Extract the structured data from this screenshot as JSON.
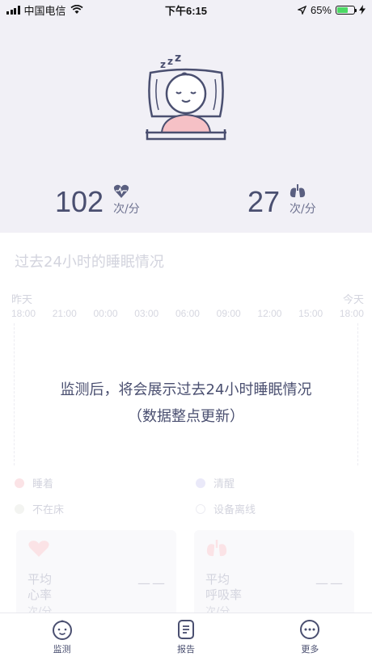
{
  "status_bar": {
    "carrier": "中国电信",
    "time": "下午6:15",
    "battery_pct": "65%",
    "battery_level": 0.65
  },
  "hero": {
    "illustration": "sleeping-baby",
    "heart_rate": {
      "value": "102",
      "unit": "次/分",
      "icon": "heart-pulse-icon"
    },
    "resp_rate": {
      "value": "27",
      "unit": "次/分",
      "icon": "lungs-icon"
    }
  },
  "sleep": {
    "title": "过去24小时的睡眠情况",
    "start_day": "昨天",
    "end_day": "今天",
    "times": [
      "18:00",
      "21:00",
      "00:00",
      "03:00",
      "06:00",
      "09:00",
      "12:00",
      "15:00",
      "18:00"
    ],
    "empty_line1": "监测后，将会展示过去24小时睡眠情况",
    "empty_line2": "（数据整点更新）",
    "legend": [
      {
        "label": "睡着",
        "color": "#fbe3e6"
      },
      {
        "label": "清醒",
        "color": "#eae9f9"
      },
      {
        "label": "不在床",
        "color": "#f3f4f1"
      },
      {
        "label": "设备离线",
        "color": "#ffffff"
      }
    ]
  },
  "cards": {
    "heart": {
      "title_line1": "平均",
      "title_line2": "心率",
      "unit": "次/分",
      "value": "——"
    },
    "resp": {
      "title_line1": "平均",
      "title_line2": "呼吸率",
      "unit": "次/分",
      "value": "——"
    }
  },
  "tabs": [
    {
      "label": "监测",
      "icon": "baby-face-icon"
    },
    {
      "label": "报告",
      "icon": "report-icon"
    },
    {
      "label": "更多",
      "icon": "more-icon"
    }
  ],
  "colors": {
    "primary": "#4a4f70",
    "hero_bg": "#f1f0f6",
    "battery": "#4cd964"
  }
}
